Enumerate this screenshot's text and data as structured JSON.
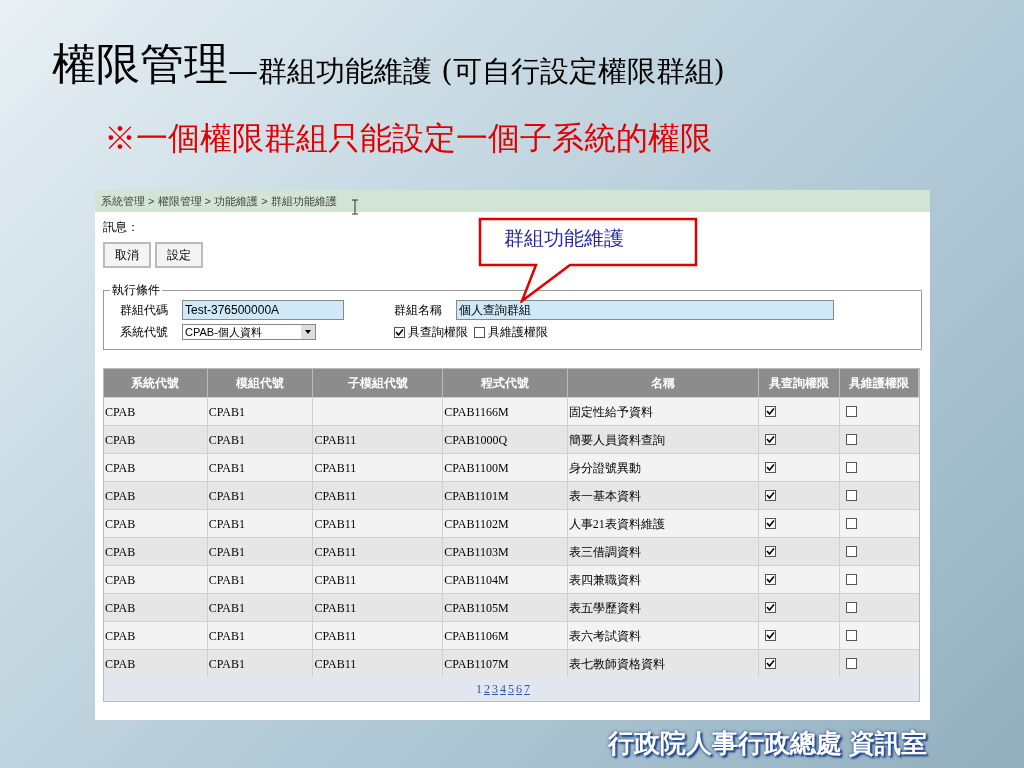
{
  "slide": {
    "title_main": "權限管理",
    "title_dash": "—",
    "title_rest": "群組功能維護 (可自行設定權限群組)",
    "note": "※一個權限群組只能設定一個子系統的權限",
    "footer": "行政院人事行政總處 資訊室"
  },
  "screen": {
    "breadcrumb": "系統管理 > 權限管理 > 功能維護 > 群組功能維護",
    "message_label": "訊息：",
    "buttons": [
      "取消",
      "設定"
    ],
    "callout": "群組功能維護",
    "conditions": {
      "legend": "執行條件",
      "group_code_label": "群組代碼",
      "group_code": "Test-376500000A",
      "group_name_label": "群組名稱",
      "group_name": "個人查詢群組",
      "system_label": "系統代號",
      "system": "CPAB-個人資料",
      "checks": [
        {
          "label": "具查詢權限",
          "checked": true
        },
        {
          "label": "具維護權限",
          "checked": false
        }
      ]
    },
    "table": {
      "columns": [
        "系統代號",
        "模組代號",
        "子模組代號",
        "程式代號",
        "名稱",
        "具查詢權限",
        "具維護權限"
      ],
      "rows": [
        {
          "cells": [
            "CPAB",
            "CPAB1",
            "",
            "CPAB1166M",
            "固定性給予資料"
          ],
          "query": true,
          "maintain": false
        },
        {
          "cells": [
            "CPAB",
            "CPAB1",
            "CPAB11",
            "CPAB1000Q",
            "簡要人員資料查詢"
          ],
          "query": true,
          "maintain": false
        },
        {
          "cells": [
            "CPAB",
            "CPAB1",
            "CPAB11",
            "CPAB1100M",
            "身分證號異動"
          ],
          "query": true,
          "maintain": false
        },
        {
          "cells": [
            "CPAB",
            "CPAB1",
            "CPAB11",
            "CPAB1101M",
            "表一基本資料"
          ],
          "query": true,
          "maintain": false
        },
        {
          "cells": [
            "CPAB",
            "CPAB1",
            "CPAB11",
            "CPAB1102M",
            "人事21表資料維護"
          ],
          "query": true,
          "maintain": false
        },
        {
          "cells": [
            "CPAB",
            "CPAB1",
            "CPAB11",
            "CPAB1103M",
            "表三借調資料"
          ],
          "query": true,
          "maintain": false
        },
        {
          "cells": [
            "CPAB",
            "CPAB1",
            "CPAB11",
            "CPAB1104M",
            "表四兼職資料"
          ],
          "query": true,
          "maintain": false
        },
        {
          "cells": [
            "CPAB",
            "CPAB1",
            "CPAB11",
            "CPAB1105M",
            "表五學歷資料"
          ],
          "query": true,
          "maintain": false
        },
        {
          "cells": [
            "CPAB",
            "CPAB1",
            "CPAB11",
            "CPAB1106M",
            "表六考試資料"
          ],
          "query": true,
          "maintain": false
        },
        {
          "cells": [
            "CPAB",
            "CPAB1",
            "CPAB11",
            "CPAB1107M",
            "表七教師資格資料"
          ],
          "query": true,
          "maintain": false
        }
      ],
      "pages": [
        {
          "label": "1",
          "selected": true
        },
        {
          "label": "2",
          "selected": false
        },
        {
          "label": "3",
          "selected": false
        },
        {
          "label": "4",
          "selected": false
        },
        {
          "label": "5",
          "selected": false
        },
        {
          "label": "6",
          "selected": false
        },
        {
          "label": "7",
          "selected": false
        }
      ]
    }
  }
}
